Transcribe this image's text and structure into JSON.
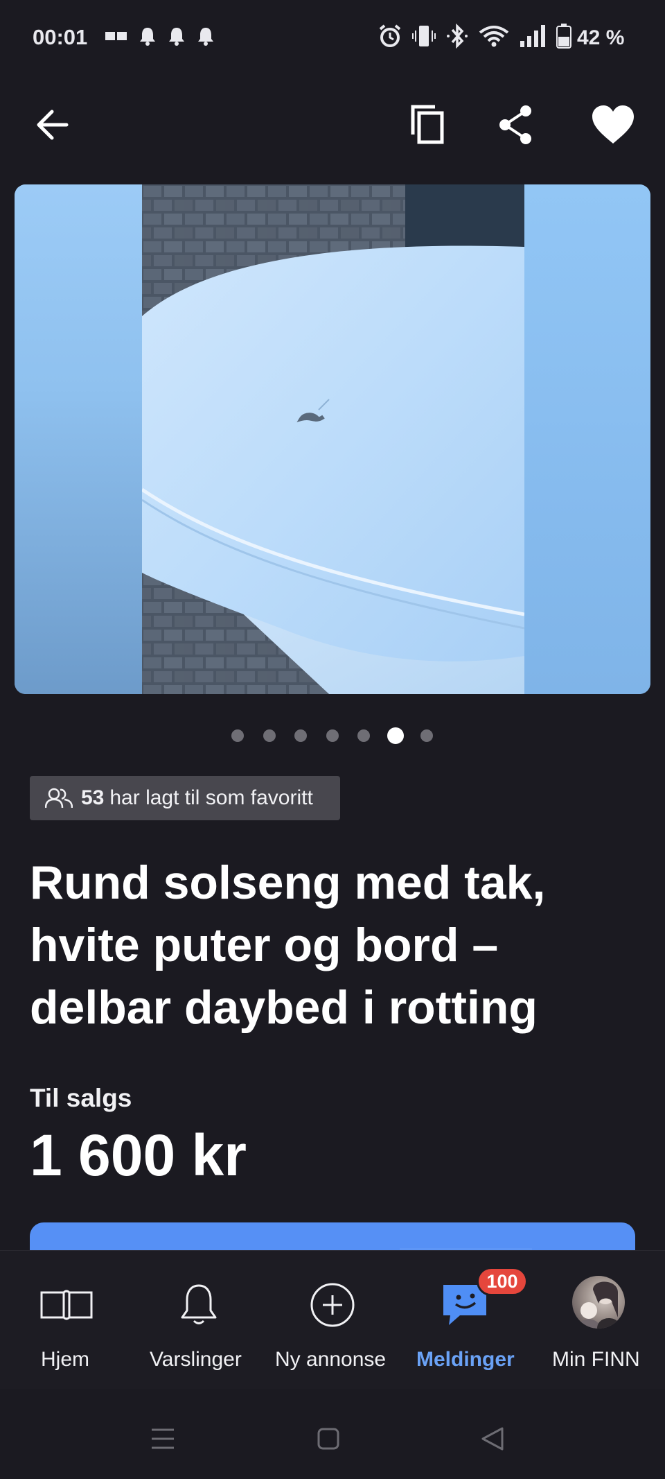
{
  "status_bar": {
    "time": "00:01",
    "battery": "42 %"
  },
  "app_bar": {
    "back_icon": "arrow-left-icon",
    "copy_icon": "copy-icon",
    "share_icon": "share-icon",
    "favorite_icon": "heart-icon"
  },
  "gallery": {
    "total_images": 7,
    "active_index": 5
  },
  "favorites": {
    "count": "53",
    "text": "har lagt til som favoritt"
  },
  "listing": {
    "title_lines": [
      "Rund solseng med tak,",
      "hvite puter og bord –",
      "delbar daybed i rotting"
    ],
    "sale_label": "Til salgs",
    "price": "1 600 kr"
  },
  "bottom_nav": {
    "items": [
      {
        "label": "Hjem",
        "icon": "book-icon"
      },
      {
        "label": "Varslinger",
        "icon": "bell-icon"
      },
      {
        "label": "Ny annonse",
        "icon": "plus-circle-icon"
      },
      {
        "label": "Meldinger",
        "icon": "chat-icon",
        "badge": "100"
      },
      {
        "label": "Min FINN",
        "icon": "avatar"
      }
    ],
    "active": "Meldinger"
  },
  "colors": {
    "background": "#1b1a21",
    "accent": "#5690f5",
    "badge": "#e5463c",
    "active_nav": "#6aa2f6"
  }
}
